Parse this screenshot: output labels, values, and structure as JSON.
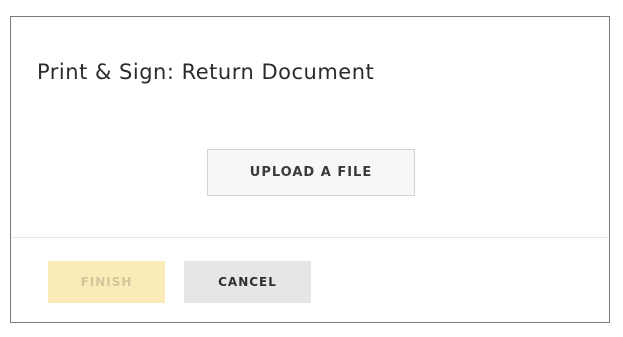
{
  "dialog": {
    "title": "Print & Sign: Return Document",
    "upload_label": "UPLOAD A FILE",
    "finish_label": "FINISH",
    "cancel_label": "CANCEL",
    "finish_disabled": true
  },
  "colors": {
    "finish_background": "#fbebb7",
    "finish_text": "#d3c69a",
    "cancel_background": "#e6e6e6",
    "upload_background": "#f7f7f7",
    "border": "#7a7a7a"
  }
}
